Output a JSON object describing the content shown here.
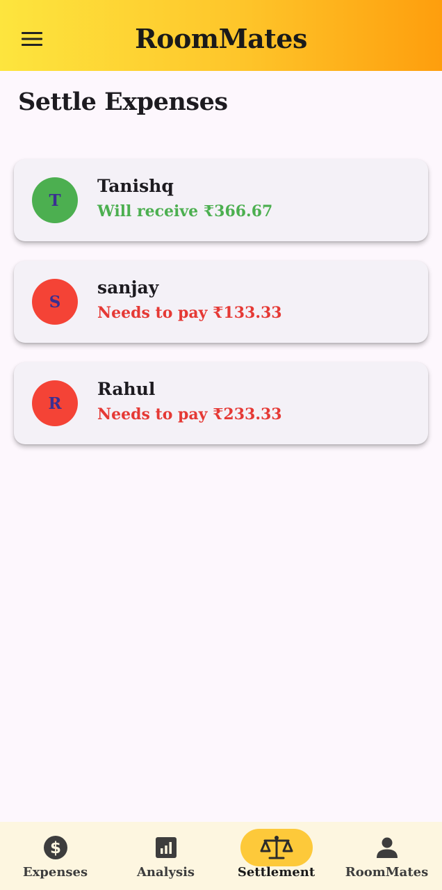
{
  "app_bar": {
    "title": "RoomMates",
    "menu_icon": "hamburger-menu-icon",
    "gradient_colors": [
      "#fde53e",
      "#fe9e0d"
    ]
  },
  "page": {
    "title": "Settle Expenses"
  },
  "settlements": [
    {
      "initial": "T",
      "name": "Tanishq",
      "status_text": "Will receive ₹366.67",
      "avatar_color": "#4caf50",
      "text_color": "#4caf50"
    },
    {
      "initial": "S",
      "name": "sanjay",
      "status_text": "Needs to pay ₹133.33",
      "avatar_color": "#f44336",
      "text_color": "#e53935"
    },
    {
      "initial": "R",
      "name": "Rahul",
      "status_text": "Needs to pay ₹233.33",
      "avatar_color": "#f44336",
      "text_color": "#e53935"
    }
  ],
  "bottom_nav": {
    "active_indicator_color": "#fdc93a",
    "items": [
      {
        "label": "Expenses",
        "icon": "dollar-circle-icon",
        "active": false
      },
      {
        "label": "Analysis",
        "icon": "bar-chart-icon",
        "active": false
      },
      {
        "label": "Settlement",
        "icon": "balance-scale-icon",
        "active": true
      },
      {
        "label": "RoomMates",
        "icon": "person-icon",
        "active": false
      }
    ]
  }
}
